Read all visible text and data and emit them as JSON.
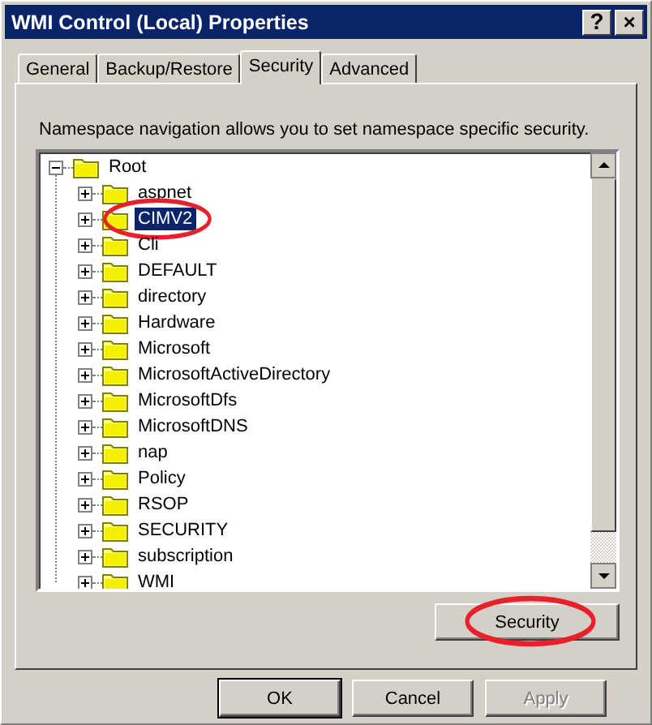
{
  "window": {
    "title": "WMI Control (Local) Properties",
    "title_buttons": [
      {
        "kind": "help",
        "label": "?"
      },
      {
        "kind": "close",
        "label": "×"
      }
    ]
  },
  "tabs": [
    {
      "label": "General",
      "selected": false
    },
    {
      "label": "Backup/Restore",
      "selected": false
    },
    {
      "label": "Security",
      "selected": true
    },
    {
      "label": "Advanced",
      "selected": false
    }
  ],
  "description": "Namespace navigation allows you to set namespace specific security.",
  "tree": {
    "label": "Root",
    "expanded": true,
    "selected": false,
    "circled": false,
    "children": [
      {
        "label": "aspnet",
        "expanded": false,
        "selected": false,
        "circled": false
      },
      {
        "label": "CIMV2",
        "expanded": false,
        "selected": true,
        "circled": true
      },
      {
        "label": "Cli",
        "expanded": false,
        "selected": false,
        "circled": false
      },
      {
        "label": "DEFAULT",
        "expanded": false,
        "selected": false,
        "circled": false
      },
      {
        "label": "directory",
        "expanded": false,
        "selected": false,
        "circled": false
      },
      {
        "label": "Hardware",
        "expanded": false,
        "selected": false,
        "circled": false
      },
      {
        "label": "Microsoft",
        "expanded": false,
        "selected": false,
        "circled": false
      },
      {
        "label": "MicrosoftActiveDirectory",
        "expanded": false,
        "selected": false,
        "circled": false
      },
      {
        "label": "MicrosoftDfs",
        "expanded": false,
        "selected": false,
        "circled": false
      },
      {
        "label": "MicrosoftDNS",
        "expanded": false,
        "selected": false,
        "circled": false
      },
      {
        "label": "nap",
        "expanded": false,
        "selected": false,
        "circled": false
      },
      {
        "label": "Policy",
        "expanded": false,
        "selected": false,
        "circled": false
      },
      {
        "label": "RSOP",
        "expanded": false,
        "selected": false,
        "circled": false
      },
      {
        "label": "SECURITY",
        "expanded": false,
        "selected": false,
        "circled": false
      },
      {
        "label": "subscription",
        "expanded": false,
        "selected": false,
        "circled": false
      },
      {
        "label": "WMI",
        "expanded": false,
        "selected": false,
        "circled": false
      }
    ]
  },
  "security_button": {
    "label": "Security",
    "circled": true
  },
  "buttons": [
    {
      "label": "OK",
      "default": true,
      "disabled": false
    },
    {
      "label": "Cancel",
      "default": false,
      "disabled": false
    },
    {
      "label": "Apply",
      "default": false,
      "disabled": true
    }
  ]
}
